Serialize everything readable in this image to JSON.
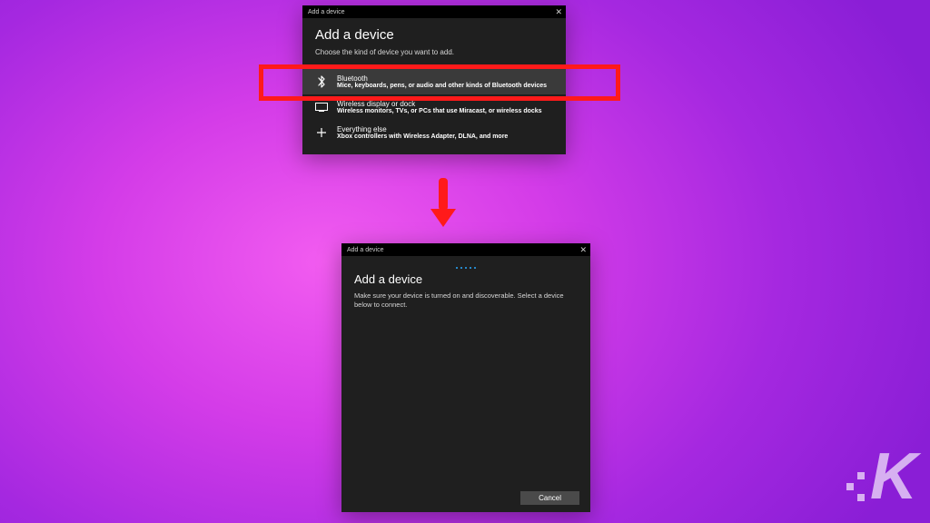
{
  "top": {
    "titlebar": "Add a device",
    "heading": "Add a device",
    "subheading": "Choose the kind of device you want to add.",
    "options": [
      {
        "icon": "bluetooth",
        "title": "Bluetooth",
        "desc": "Mice, keyboards, pens, or audio and other kinds of Bluetooth devices"
      },
      {
        "icon": "display",
        "title": "Wireless display or dock",
        "desc": "Wireless monitors, TVs, or PCs that use Miracast, or wireless docks"
      },
      {
        "icon": "plus",
        "title": "Everything else",
        "desc": "Xbox controllers with Wireless Adapter, DLNA, and more"
      }
    ]
  },
  "bottom": {
    "titlebar": "Add a device",
    "heading": "Add a device",
    "instruction": "Make sure your device is turned on and discoverable. Select a device below to connect.",
    "cancel": "Cancel"
  },
  "icons": {
    "bluetooth": "B",
    "display": "▭",
    "plus": "+",
    "close": "✕"
  }
}
